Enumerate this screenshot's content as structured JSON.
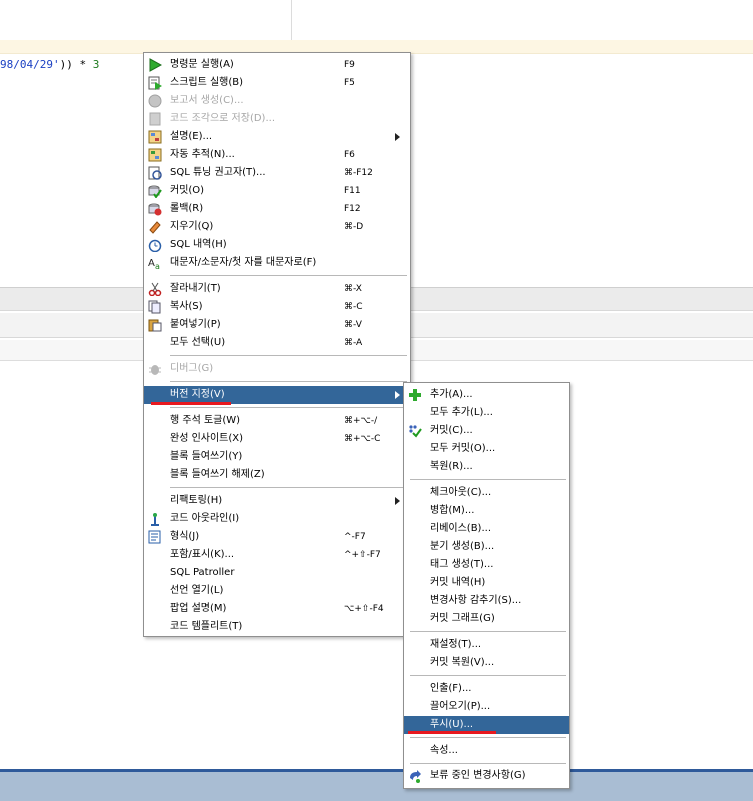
{
  "editor": {
    "code_prefix": "98/04/29'",
    "code_rest": ")) * ",
    "code_num": "3"
  },
  "colors": {
    "menu_highlight": "#336699",
    "annotation_underline": "#e8191f",
    "status_bar": "#a9bdd3"
  },
  "context_menu": {
    "items": [
      {
        "label": "명령문 실행(A)",
        "shortcut": "F9",
        "icon": "run-statement-icon"
      },
      {
        "label": "스크립트 실행(B)",
        "shortcut": "F5",
        "icon": "run-script-icon"
      },
      {
        "label": "보고서 생성(C)...",
        "shortcut": "",
        "icon": "report-icon",
        "disabled": true
      },
      {
        "label": "코드 조각으로 저장(D)...",
        "shortcut": "",
        "icon": "save-snippet-icon",
        "disabled": true
      },
      {
        "label": "설명(E)...",
        "shortcut": "",
        "icon": "explain-plan-icon"
      },
      {
        "label": "자동 추적(N)...",
        "shortcut": "F6",
        "icon": "autotrace-icon"
      },
      {
        "label": "SQL 튜닝 권고자(T)...",
        "shortcut": "⌘-F12",
        "icon": "tuning-advisor-icon"
      },
      {
        "label": "커밋(O)",
        "shortcut": "F11",
        "icon": "commit-icon"
      },
      {
        "label": "롤백(R)",
        "shortcut": "F12",
        "icon": "rollback-icon"
      },
      {
        "label": "지우기(Q)",
        "shortcut": "⌘-D",
        "icon": "eraser-icon"
      },
      {
        "label": "SQL 내역(H)",
        "shortcut": "",
        "icon": "history-icon"
      },
      {
        "label": "대문자/소문자/첫 자를 대문자로(F)",
        "shortcut": "",
        "icon": "case-toggle-icon"
      },
      {
        "label": "잘라내기(T)",
        "shortcut": "⌘-X",
        "icon": "scissors-icon"
      },
      {
        "label": "복사(S)",
        "shortcut": "⌘-C",
        "icon": "copy-icon"
      },
      {
        "label": "붙여넣기(P)",
        "shortcut": "⌘-V",
        "icon": "paste-icon"
      },
      {
        "label": "모두 선택(U)",
        "shortcut": "⌘-A",
        "icon": ""
      },
      {
        "label": "디버그(G)",
        "shortcut": "",
        "icon": "debug-bug-icon",
        "disabled": true
      },
      {
        "label": "버전 지정(V)",
        "shortcut": "",
        "icon": "",
        "selected": true
      },
      {
        "label": "행 주석 토글(W)",
        "shortcut": "⌘+⌥-/",
        "icon": ""
      },
      {
        "label": "완성 인사이트(X)",
        "shortcut": "⌘+⌥-C",
        "icon": ""
      },
      {
        "label": "블록 들여쓰기(Y)",
        "shortcut": "",
        "icon": ""
      },
      {
        "label": "블록 들여쓰기 해제(Z)",
        "shortcut": "",
        "icon": ""
      },
      {
        "label": "리팩토링(H)",
        "shortcut": "",
        "icon": ""
      },
      {
        "label": "코드 아웃라인(I)",
        "shortcut": "",
        "icon": "code-outline-icon"
      },
      {
        "label": "형식(J)",
        "shortcut": "^-F7",
        "icon": "format-icon"
      },
      {
        "label": "포함/표시(K)...",
        "shortcut": "^+⇧-F7",
        "icon": ""
      },
      {
        "label": "SQL Patroller",
        "shortcut": "",
        "icon": ""
      },
      {
        "label": "선언 열기(L)",
        "shortcut": "",
        "icon": ""
      },
      {
        "label": "팝업 설명(M)",
        "shortcut": "⌥+⇧-F4",
        "icon": ""
      },
      {
        "label": "코드 템플리트(T)",
        "shortcut": "",
        "icon": ""
      }
    ]
  },
  "versioning_submenu": {
    "items": [
      {
        "label": "추가(A)...",
        "icon": "add-plus-icon"
      },
      {
        "label": "모두 추가(L)...",
        "icon": ""
      },
      {
        "label": "커밋(C)...",
        "icon": "commit-changes-icon"
      },
      {
        "label": "모두 커밋(O)...",
        "icon": ""
      },
      {
        "label": "복원(R)...",
        "icon": ""
      },
      {
        "label": "체크아웃(C)...",
        "icon": ""
      },
      {
        "label": "병합(M)...",
        "icon": ""
      },
      {
        "label": "리베이스(B)...",
        "icon": ""
      },
      {
        "label": "분기 생성(B)...",
        "icon": ""
      },
      {
        "label": "태그 생성(T)...",
        "icon": ""
      },
      {
        "label": "커밋 내역(H)",
        "icon": ""
      },
      {
        "label": "변경사항 감추기(S)...",
        "icon": ""
      },
      {
        "label": "커밋 그래프(G)",
        "icon": ""
      },
      {
        "label": "재설정(T)...",
        "icon": ""
      },
      {
        "label": "커밋 복원(V)...",
        "icon": ""
      },
      {
        "label": "인출(F)...",
        "icon": ""
      },
      {
        "label": "끌어오기(P)...",
        "icon": ""
      },
      {
        "label": "푸시(U)...",
        "icon": "",
        "selected": true
      },
      {
        "label": "속성...",
        "icon": ""
      },
      {
        "label": "보류 중인 변경사항(G)",
        "icon": "pending-changes-icon"
      }
    ]
  }
}
